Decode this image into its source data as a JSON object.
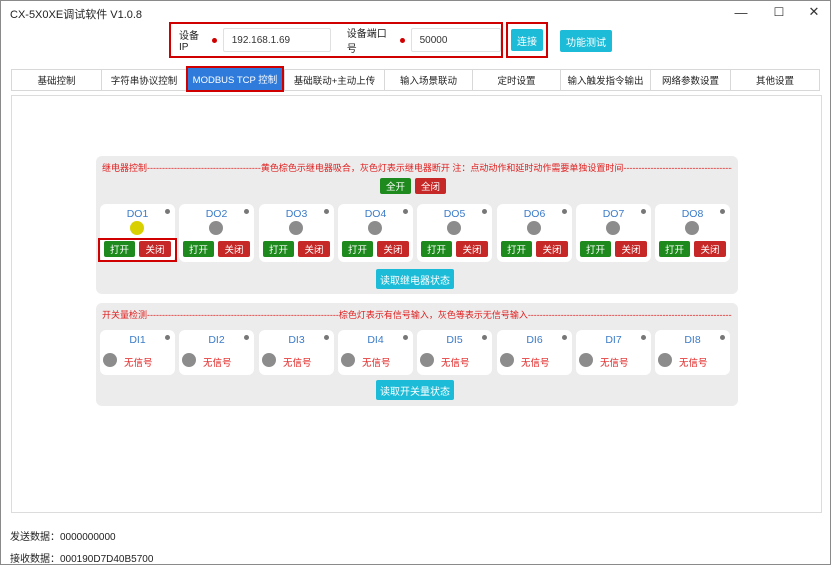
{
  "window": {
    "title": "CX-5X0XE调试软件 V1.0.8",
    "minimize_glyph": "—",
    "maximize_glyph": "☐",
    "close_glyph": "✕"
  },
  "connection": {
    "ip_label": "设备IP",
    "ip_value": "192.168.1.69",
    "port_label": "设备端口号",
    "port_value": "50000",
    "connect_button": "连接",
    "function_test_button": "功能测试"
  },
  "tabs": [
    "基础控制",
    "字符串协议控制",
    "MODBUS TCP 控制",
    "基础联动+主动上传",
    "输入场景联动",
    "定时设置",
    "输入触发指令输出",
    "网络参数设置",
    "其他设置"
  ],
  "relay_panel": {
    "title": "继电器控制--------------------------------------黄色棕色示继电器吸合，灰色灯表示继电器断开    注：点动动作和延时动作需要单独设置时间--------------------------------------------",
    "all_on": "全开",
    "all_off": "全闭",
    "outputs": [
      {
        "name": "DO1",
        "on": true
      },
      {
        "name": "DO2",
        "on": false
      },
      {
        "name": "DO3",
        "on": false
      },
      {
        "name": "DO4",
        "on": false
      },
      {
        "name": "DO5",
        "on": false
      },
      {
        "name": "DO6",
        "on": false
      },
      {
        "name": "DO7",
        "on": false
      },
      {
        "name": "DO8",
        "on": false
      }
    ],
    "open_label": "打开",
    "close_label": "关闭",
    "read_button": "读取继电器状态"
  },
  "input_panel": {
    "title": "开关量检测----------------------------------------------------------------棕色灯表示有信号输入，灰色等表示无信号输入------------------------------------------------------------------------------",
    "inputs": [
      "DI1",
      "DI2",
      "DI3",
      "DI4",
      "DI5",
      "DI6",
      "DI7",
      "DI8"
    ],
    "no_signal": "无信号",
    "read_button": "读取开关量状态"
  },
  "status": {
    "send_label": "发送数据：",
    "send_value": "0000000000",
    "recv_label": "接收数据：",
    "recv_value": "000190D7D40B5700"
  },
  "colors": {
    "accent_tab": "#2e7bdb",
    "cyan_button": "#1cbcd8",
    "open_green": "#1e8a1e",
    "close_red": "#c62828",
    "lamp_on": "#d8d000",
    "lamp_off": "#8c8c8c",
    "highlight_red": "#d00000"
  }
}
